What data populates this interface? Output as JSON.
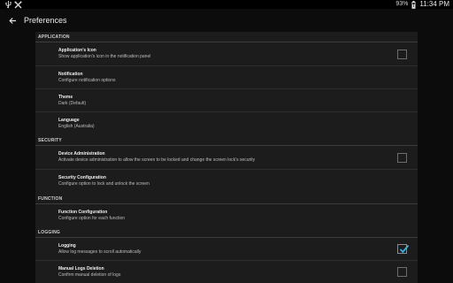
{
  "status_bar": {
    "left_icons": [
      "usb-icon",
      "tools-icon"
    ],
    "battery_percent": "93%",
    "time": "11:34 PM"
  },
  "app_bar": {
    "title": "Preferences"
  },
  "sections": [
    {
      "header": "APPLICATION"
    },
    {
      "header": "SECURITY"
    },
    {
      "header": "FUNCTION"
    },
    {
      "header": "LOGGING"
    }
  ],
  "items": [
    {
      "title": "Application's Icon",
      "summary": "Show application's icon in the notification panel",
      "checkbox": true,
      "checked": false
    },
    {
      "title": "Notification",
      "summary": "Configure notification options"
    },
    {
      "title": "Theme",
      "summary": "Dark (Default)"
    },
    {
      "title": "Language",
      "summary": "English (Australia)"
    },
    {
      "title": "Device Administration",
      "summary": "Activate device administration to allow the screen to be locked and change the screen lock's security",
      "checkbox": true,
      "checked": false
    },
    {
      "title": "Security Configuration",
      "summary": "Configure option to lock and unlock the screen"
    },
    {
      "title": "Function Configuration",
      "summary": "Configure option for each function"
    },
    {
      "title": "Logging",
      "summary": "Allow log messages to scroll automatically",
      "checkbox": true,
      "checked": true
    },
    {
      "title": "Manual Logs Deletion",
      "summary": "Confirm manual deletion of logs",
      "checkbox": true,
      "checked": false
    }
  ],
  "colors": {
    "accent": "#33b5e5",
    "background": "#0c0c0c",
    "panel": "#1c1c1c"
  }
}
